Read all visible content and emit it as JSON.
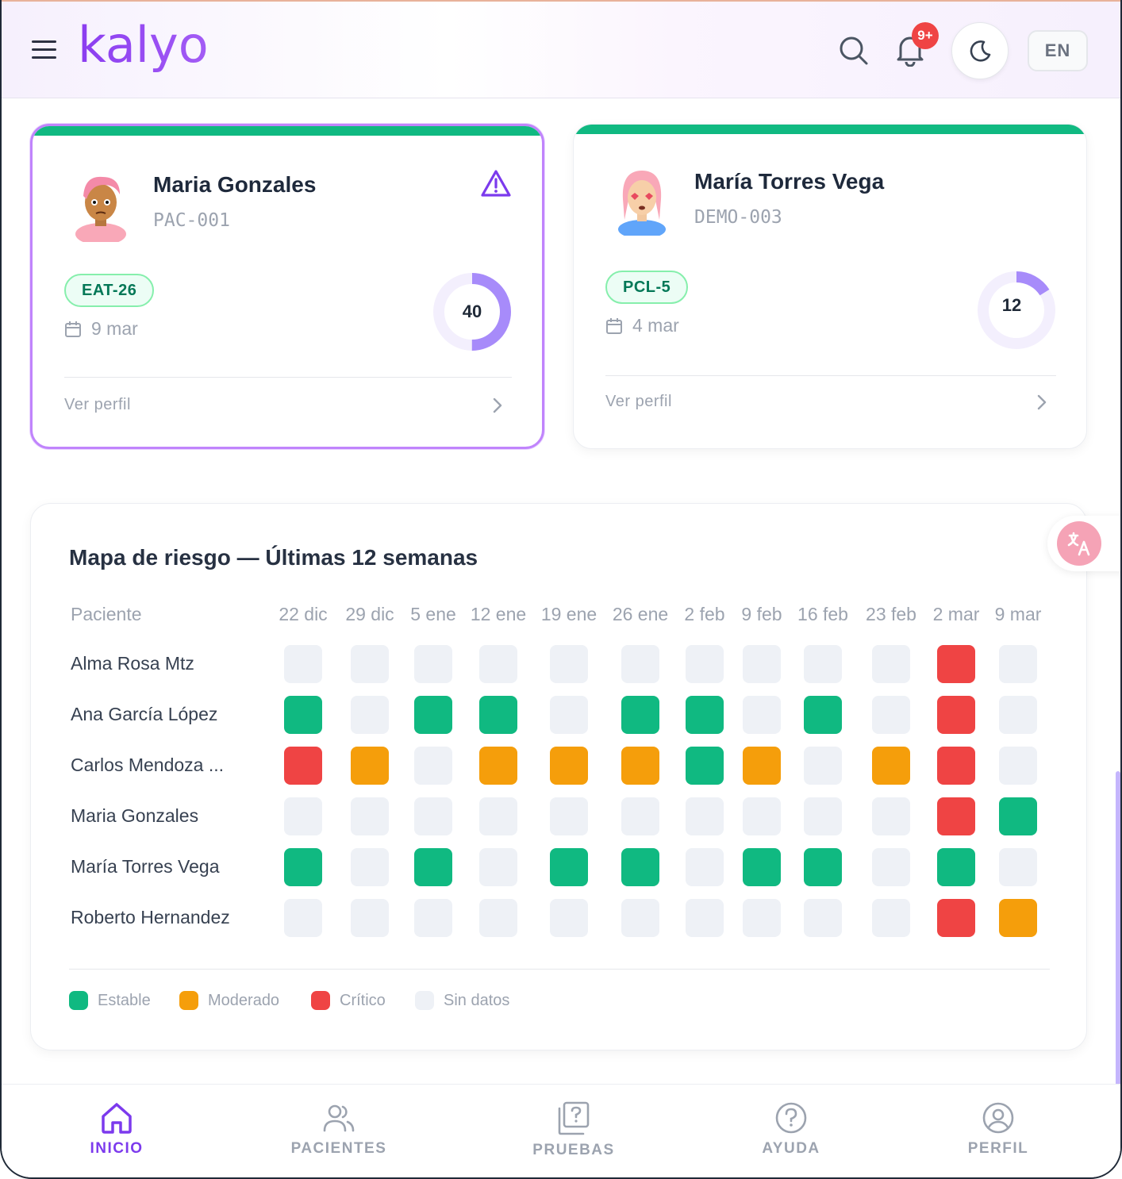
{
  "app": {
    "logo_text": "kalyo"
  },
  "header": {
    "notifications_badge": "9+",
    "language_label": "EN",
    "icons": {
      "menu": "menu-icon",
      "search": "search-icon",
      "bell": "bell-icon",
      "theme": "moon-icon"
    }
  },
  "patients": [
    {
      "name": "Maria Gonzales",
      "code": "PAC-001",
      "test": "EAT-26",
      "date": "9 mar",
      "score": "40",
      "score_fraction": 0.5,
      "has_alert": true,
      "link": "Ver perfil"
    },
    {
      "name": "María Torres Vega",
      "code": "DEMO-003",
      "test": "PCL-5",
      "date": "4 mar",
      "score": "12",
      "score_fraction": 0.16,
      "has_alert": false,
      "link": "Ver perfil"
    }
  ],
  "risk_map": {
    "title": "Mapa de riesgo — Últimas 12 semanas",
    "patient_header": "Paciente",
    "weeks": [
      "22 dic",
      "29 dic",
      "5 ene",
      "12 ene",
      "19 ene",
      "26 ene",
      "2 feb",
      "9 feb",
      "16 feb",
      "23 feb",
      "2 mar",
      "9 mar"
    ],
    "rows": [
      {
        "name": "Alma Rosa Mtz",
        "cells": [
          "n",
          "n",
          "n",
          "n",
          "n",
          "n",
          "n",
          "n",
          "n",
          "n",
          "c",
          "n"
        ]
      },
      {
        "name": "Ana García López",
        "cells": [
          "s",
          "n",
          "s",
          "s",
          "n",
          "s",
          "s",
          "n",
          "s",
          "n",
          "c",
          "n"
        ]
      },
      {
        "name": "Carlos Mendoza ...",
        "cells": [
          "c",
          "m",
          "n",
          "m",
          "m",
          "m",
          "s",
          "m",
          "n",
          "m",
          "c",
          "n"
        ]
      },
      {
        "name": "Maria Gonzales",
        "cells": [
          "n",
          "n",
          "n",
          "n",
          "n",
          "n",
          "n",
          "n",
          "n",
          "n",
          "c",
          "s"
        ]
      },
      {
        "name": "María Torres Vega",
        "cells": [
          "s",
          "n",
          "s",
          "n",
          "s",
          "s",
          "n",
          "s",
          "s",
          "n",
          "s",
          "n"
        ]
      },
      {
        "name": "Roberto Hernandez",
        "cells": [
          "n",
          "n",
          "n",
          "n",
          "n",
          "n",
          "n",
          "n",
          "n",
          "n",
          "c",
          "m"
        ]
      }
    ],
    "legend": [
      {
        "key": "s",
        "label": "Estable",
        "color": "#10b981"
      },
      {
        "key": "m",
        "label": "Moderado",
        "color": "#f59e0b"
      },
      {
        "key": "c",
        "label": "Crítico",
        "color": "#ef4444"
      },
      {
        "key": "n",
        "label": "Sin datos",
        "color": "#eef1f6"
      }
    ]
  },
  "bottom_nav": [
    {
      "label": "INICIO",
      "icon": "home-icon",
      "active": true
    },
    {
      "label": "PACIENTES",
      "icon": "users-icon",
      "active": false
    },
    {
      "label": "PRUEBAS",
      "icon": "tests-icon",
      "active": false
    },
    {
      "label": "AYUDA",
      "icon": "help-icon",
      "active": false
    },
    {
      "label": "PERFIL",
      "icon": "profile-icon",
      "active": false
    }
  ]
}
